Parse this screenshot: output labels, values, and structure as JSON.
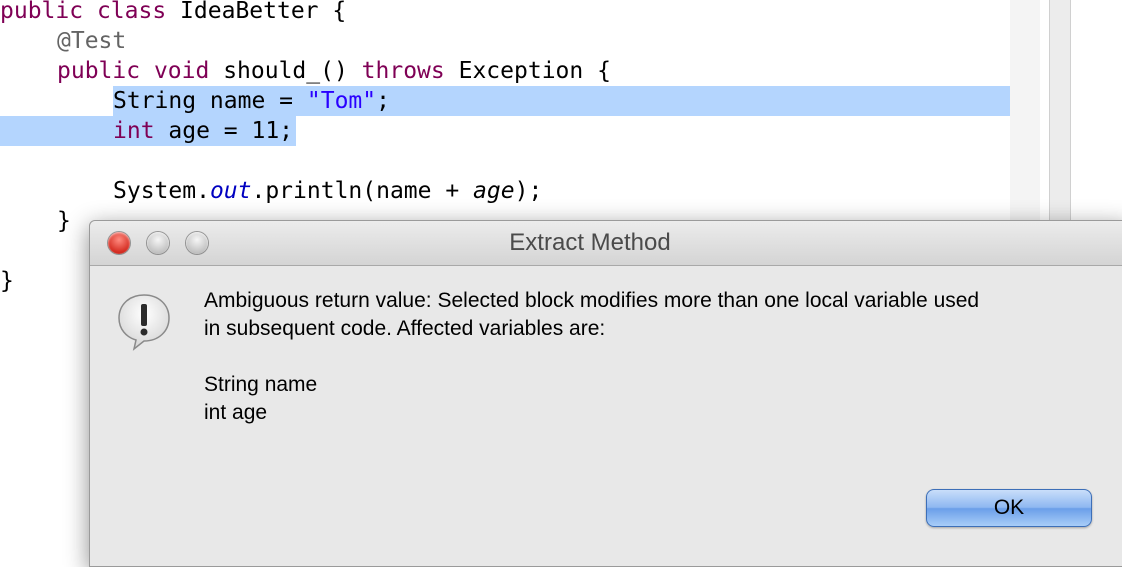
{
  "editor": {
    "line1": {
      "kw1": "public",
      "kw2": "class",
      "rest": " IdeaBetter {"
    },
    "line2": {
      "annotation": "@Test"
    },
    "line3": {
      "kw1": "public",
      "kw2": "void",
      "mid": " should_() ",
      "kw3": "throws",
      "rest": " Exception {"
    },
    "line4": {
      "type": "String name = ",
      "string": "\"Tom\"",
      "end": ";"
    },
    "line5": {
      "kw": "int",
      "rest": " age = 11;"
    },
    "line7": {
      "pre": "System.",
      "field": "out",
      "mid": ".println(name + ",
      "var": "age",
      "end": ");"
    },
    "line8": {
      "text": "}"
    },
    "line10": {
      "text": "}"
    }
  },
  "dialog": {
    "title": "Extract Method",
    "message_line1": "Ambiguous return value: Selected block modifies more than one local variable used",
    "message_line2": "in subsequent code. Affected variables are:",
    "variables": [
      "String name",
      "int age"
    ],
    "ok_label": "OK"
  },
  "colors": {
    "keyword": "#7f0055",
    "string": "#2a00ff",
    "selection": "#b4d5fe",
    "ok_button": "#8fb8f1"
  }
}
